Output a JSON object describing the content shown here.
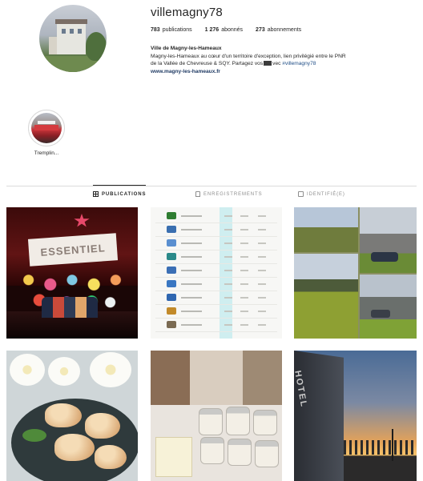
{
  "profile": {
    "username": "villemagny78",
    "stats": {
      "posts_count": "783",
      "posts_label": "publications",
      "followers_count": "1 276",
      "followers_label": "abonnés",
      "following_count": "273",
      "following_label": "abonnements"
    },
    "bio": {
      "name": "Ville de Magny-les-Hameaux",
      "line1": "Magny-les-Hameaux au cœur d'un territoire d'exception, lien privilégié entre le PNR",
      "line2_prefix": "de la Vallée de Chevreuse & SQY. Partagez vos",
      "line2_mid": "vec",
      "hashtag": "#villemagny78",
      "website": "www.magny-les-hameaux.fr"
    }
  },
  "highlights": [
    {
      "label": "Tremplin..."
    }
  ],
  "tabs": {
    "publications": "PUBLICATIONS",
    "enregistrements": "ENREGISTREMENTS",
    "identifie": "IDENTIFIÉ(E)"
  },
  "posts": [
    {
      "id": "stage-show",
      "banner_text": "ESSENTIEL"
    },
    {
      "id": "ranking-table"
    },
    {
      "id": "roads-collage"
    },
    {
      "id": "food-plate"
    },
    {
      "id": "jars-market"
    },
    {
      "id": "hotel-sunset",
      "sign_text": "HOTEL"
    }
  ],
  "colors": {
    "text": "#262626",
    "muted": "#8e8e8e",
    "link": "#1f3a63",
    "divider": "#dbdbdb"
  }
}
